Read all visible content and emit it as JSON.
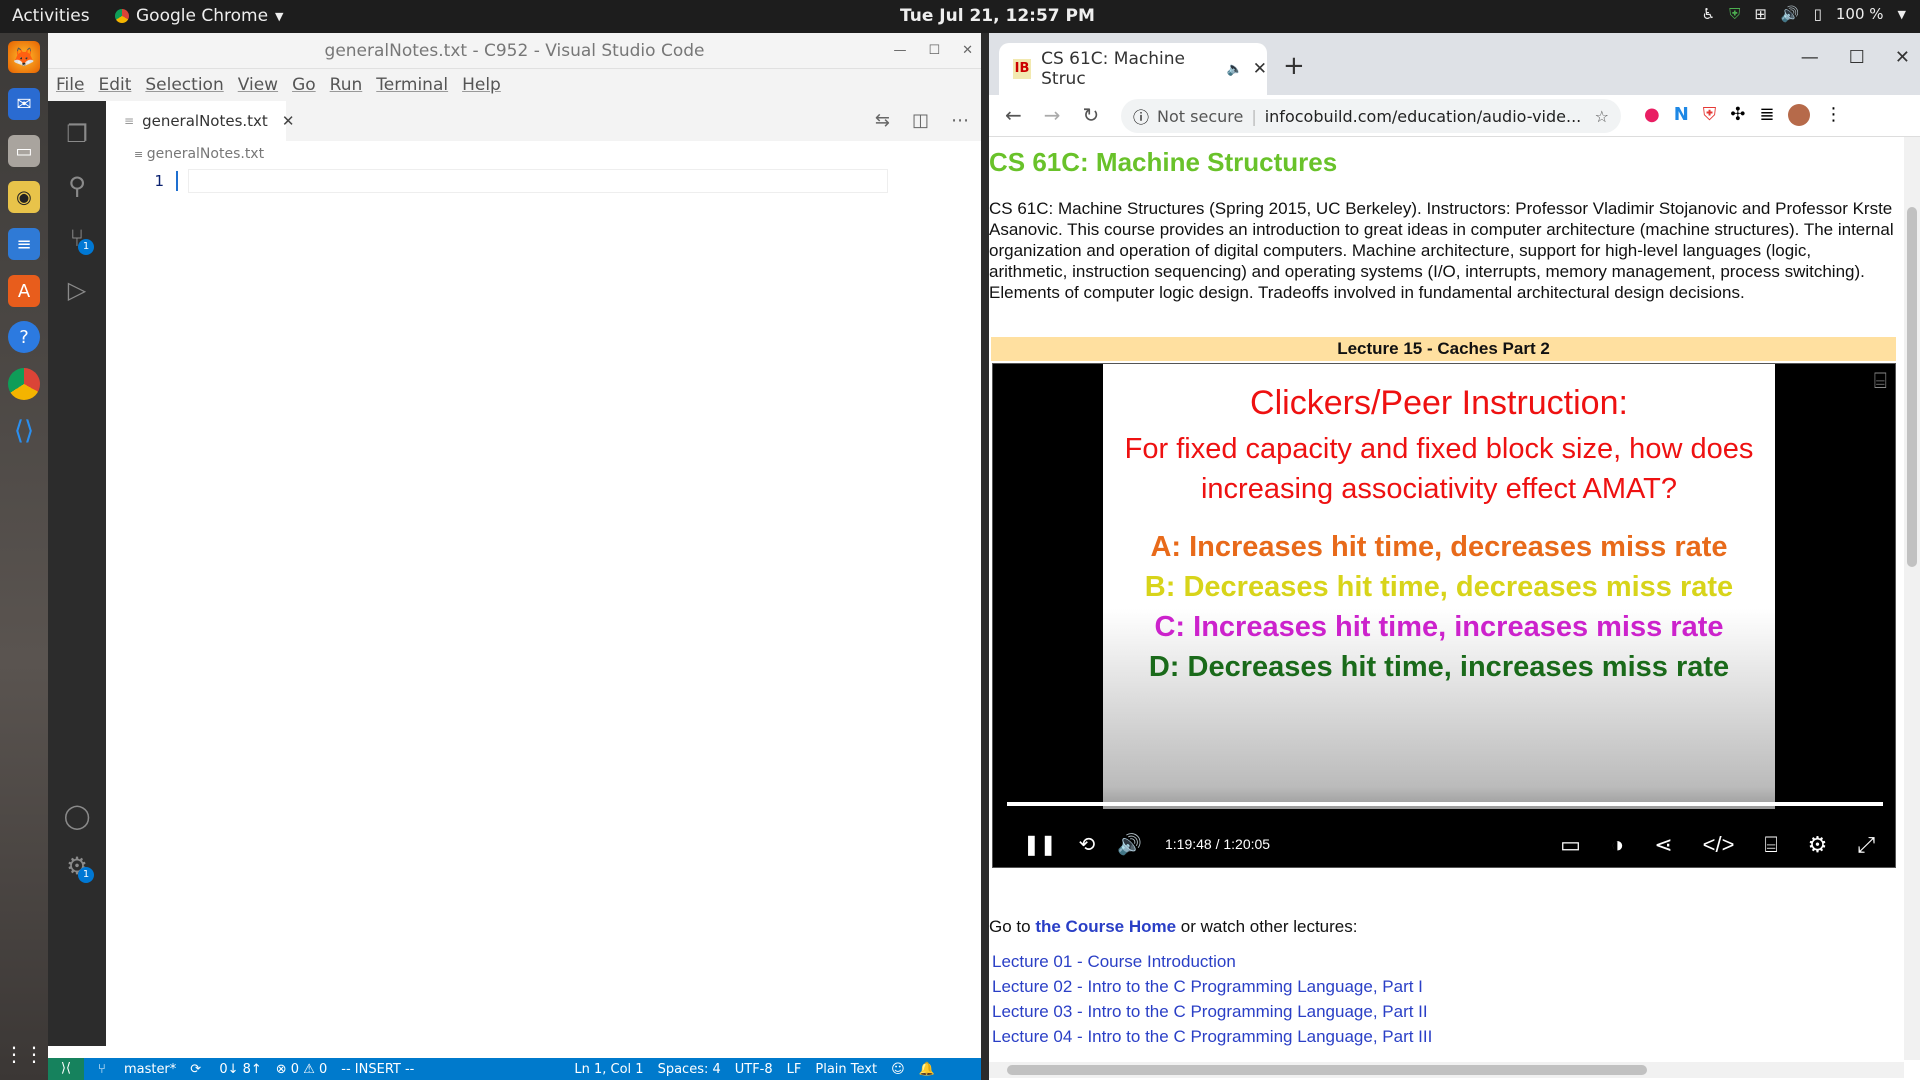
{
  "topbar": {
    "activities": "Activities",
    "app_name": "Google Chrome",
    "clock": "Tue Jul 21, 12:57 PM",
    "battery": "100 %"
  },
  "dock": {
    "items": [
      "firefox-icon",
      "thunderbird-icon",
      "files-icon",
      "rhythmbox-icon",
      "writer-icon",
      "software-icon",
      "help-icon",
      "chrome-icon",
      "vscode-icon",
      "apps-grid-icon"
    ]
  },
  "vscode": {
    "title": "generalNotes.txt - C952 - Visual Studio Code",
    "menu": [
      "File",
      "Edit",
      "Selection",
      "View",
      "Go",
      "Run",
      "Terminal",
      "Help"
    ],
    "tab_label": "generalNotes.txt",
    "breadcrumb": "generalNotes.txt",
    "line_number": "1",
    "scm_badge": "1",
    "settings_badge": "1",
    "status": {
      "branch": "master*",
      "sync": "0↓ 8↑",
      "problems": "⊗ 0 ⚠ 0",
      "mode": "-- INSERT --",
      "position": "Ln 1, Col 1",
      "spaces": "Spaces: 4",
      "encoding": "UTF-8",
      "eol": "LF",
      "language": "Plain Text"
    }
  },
  "chrome": {
    "tab_title": "CS 61C: Machine Struc",
    "favicon_text": "IB",
    "not_secure": "Not secure",
    "url": "infocobuild.com/education/audio-vide...",
    "page": {
      "heading": "CS 61C: Machine Structures",
      "description": "CS 61C: Machine Structures (Spring 2015, UC Berkeley). Instructors: Professor Vladimir Stojanovic and Professor Krste Asanovic. This course provides an introduction to great ideas in computer architecture (machine structures). The internal organization and operation of digital computers. Machine architecture, support for high-level languages (logic, arithmetic, instruction sequencing) and operating systems (I/O, interrupts, memory management, process switching). Elements of computer logic design. Tradeoffs involved in fundamental architectural design decisions.",
      "lecture_bar": "Lecture 15 - Caches Part 2",
      "slide": {
        "title": "Clickers/Peer Instruction:",
        "question": "For fixed capacity and fixed block size, how does increasing associativity effect AMAT?",
        "options": [
          {
            "text": "A: Increases hit time, decreases miss rate",
            "color": "#e86a1a"
          },
          {
            "text": "B: Decreases hit time, decreases miss rate",
            "color": "#d8d41a"
          },
          {
            "text": "C: Increases hit time, increases miss rate",
            "color": "#cc22cc"
          },
          {
            "text": "D: Decreases hit time, increases miss rate",
            "color": "#1a6a1a"
          }
        ]
      },
      "video_time": "1:19:48  /  1:20:05",
      "video_progress": 0.997,
      "goto_prefix": "Go to ",
      "goto_link": "the Course Home",
      "goto_suffix": " or watch other lectures:",
      "lectures": [
        "Lecture 01 - Course Introduction",
        "Lecture 02 - Intro to the C Programming Language, Part I",
        "Lecture 03 - Intro to the C Programming Language, Part II",
        "Lecture 04 - Intro to the C Programming Language, Part III"
      ]
    }
  }
}
